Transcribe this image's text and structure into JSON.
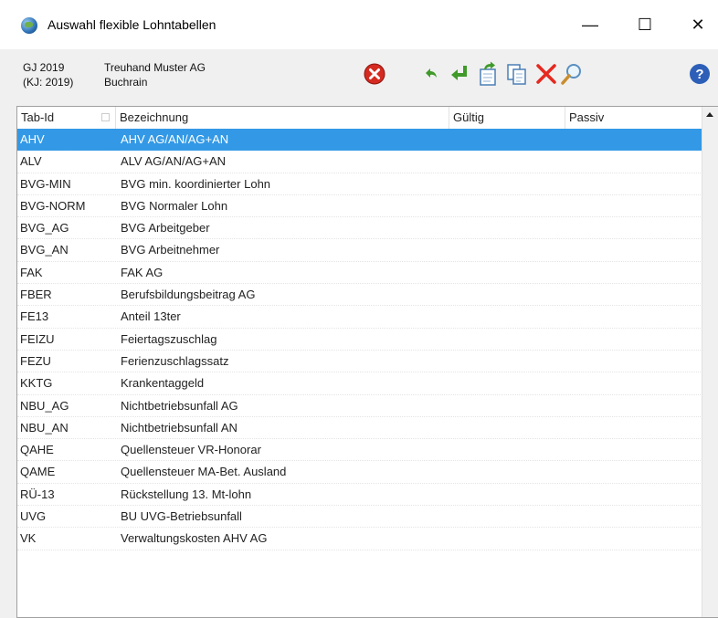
{
  "window": {
    "title": "Auswahl flexible Lohntabellen",
    "controls": {
      "minimize": "—",
      "maximize": "☐",
      "close": "✕"
    }
  },
  "info": {
    "gj": "GJ 2019",
    "kj": "(KJ: 2019)",
    "company": "Treuhand Muster AG",
    "location": "Buchrain"
  },
  "toolbar": {
    "icons": [
      "cancel-icon",
      "undo-icon",
      "enter-icon",
      "export-icon",
      "copy-icon",
      "delete-icon",
      "search-icon",
      "help-icon"
    ],
    "colors": {
      "cancel": "#d42a20",
      "green": "#3f9a2a",
      "delete": "#e5291f",
      "help": "#2d5fb8"
    }
  },
  "table": {
    "columns": [
      "Tab-Id",
      "Bezeichnung",
      "Gültig",
      "Passiv"
    ],
    "selected_index": 0,
    "selection_color": "#3399e6",
    "rows": [
      {
        "id": "AHV",
        "bez": "AHV AG/AN/AG+AN"
      },
      {
        "id": "ALV",
        "bez": "ALV AG/AN/AG+AN"
      },
      {
        "id": "BVG-MIN",
        "bez": "BVG min. koordinierter Lohn"
      },
      {
        "id": "BVG-NORM",
        "bez": "BVG Normaler Lohn"
      },
      {
        "id": "BVG_AG",
        "bez": "BVG Arbeitgeber"
      },
      {
        "id": "BVG_AN",
        "bez": "BVG Arbeitnehmer"
      },
      {
        "id": "FAK",
        "bez": "FAK AG"
      },
      {
        "id": "FBER",
        "bez": "Berufsbildungsbeitrag AG"
      },
      {
        "id": "FE13",
        "bez": "Anteil 13ter"
      },
      {
        "id": "FEIZU",
        "bez": "Feiertagszuschlag"
      },
      {
        "id": "FEZU",
        "bez": "Ferienzuschlagssatz"
      },
      {
        "id": "KKTG",
        "bez": "Krankentaggeld"
      },
      {
        "id": "NBU_AG",
        "bez": "Nichtbetriebsunfall AG"
      },
      {
        "id": "NBU_AN",
        "bez": "Nichtbetriebsunfall AN"
      },
      {
        "id": "QAHE",
        "bez": "Quellensteuer VR-Honorar"
      },
      {
        "id": "QAME",
        "bez": "Quellensteuer MA-Bet. Ausland"
      },
      {
        "id": "RÜ-13",
        "bez": "Rückstellung 13. Mt-lohn"
      },
      {
        "id": "UVG",
        "bez": "BU UVG-Betriebsunfall"
      },
      {
        "id": "VK",
        "bez": "Verwaltungskosten AHV AG"
      }
    ]
  }
}
